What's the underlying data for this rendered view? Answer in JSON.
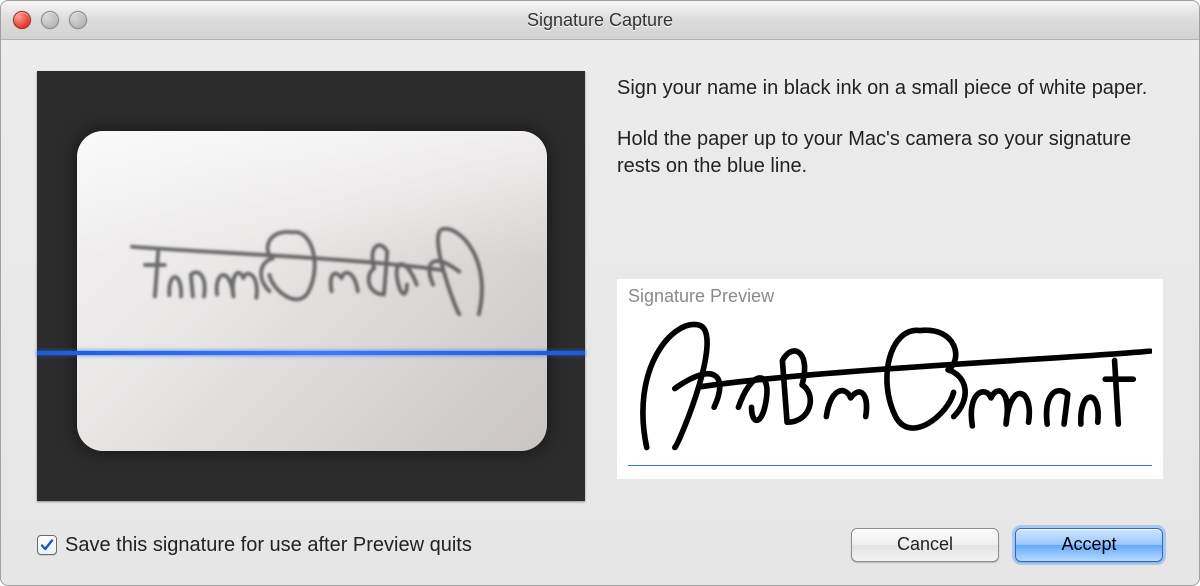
{
  "window": {
    "title": "Signature Capture"
  },
  "instructions": {
    "line1": "Sign your name in black ink on a small piece of white paper.",
    "line2": "Hold the paper up to your Mac's camera so your signature rests on the blue line."
  },
  "preview": {
    "label": "Signature Preview",
    "signature_name": "John Appleseed"
  },
  "footer": {
    "save_checkbox_label": "Save this signature for use after Preview quits",
    "save_checked": true,
    "cancel_label": "Cancel",
    "accept_label": "Accept"
  },
  "colors": {
    "guide_line": "#2a6af0",
    "preview_line": "#3b6fe6"
  }
}
